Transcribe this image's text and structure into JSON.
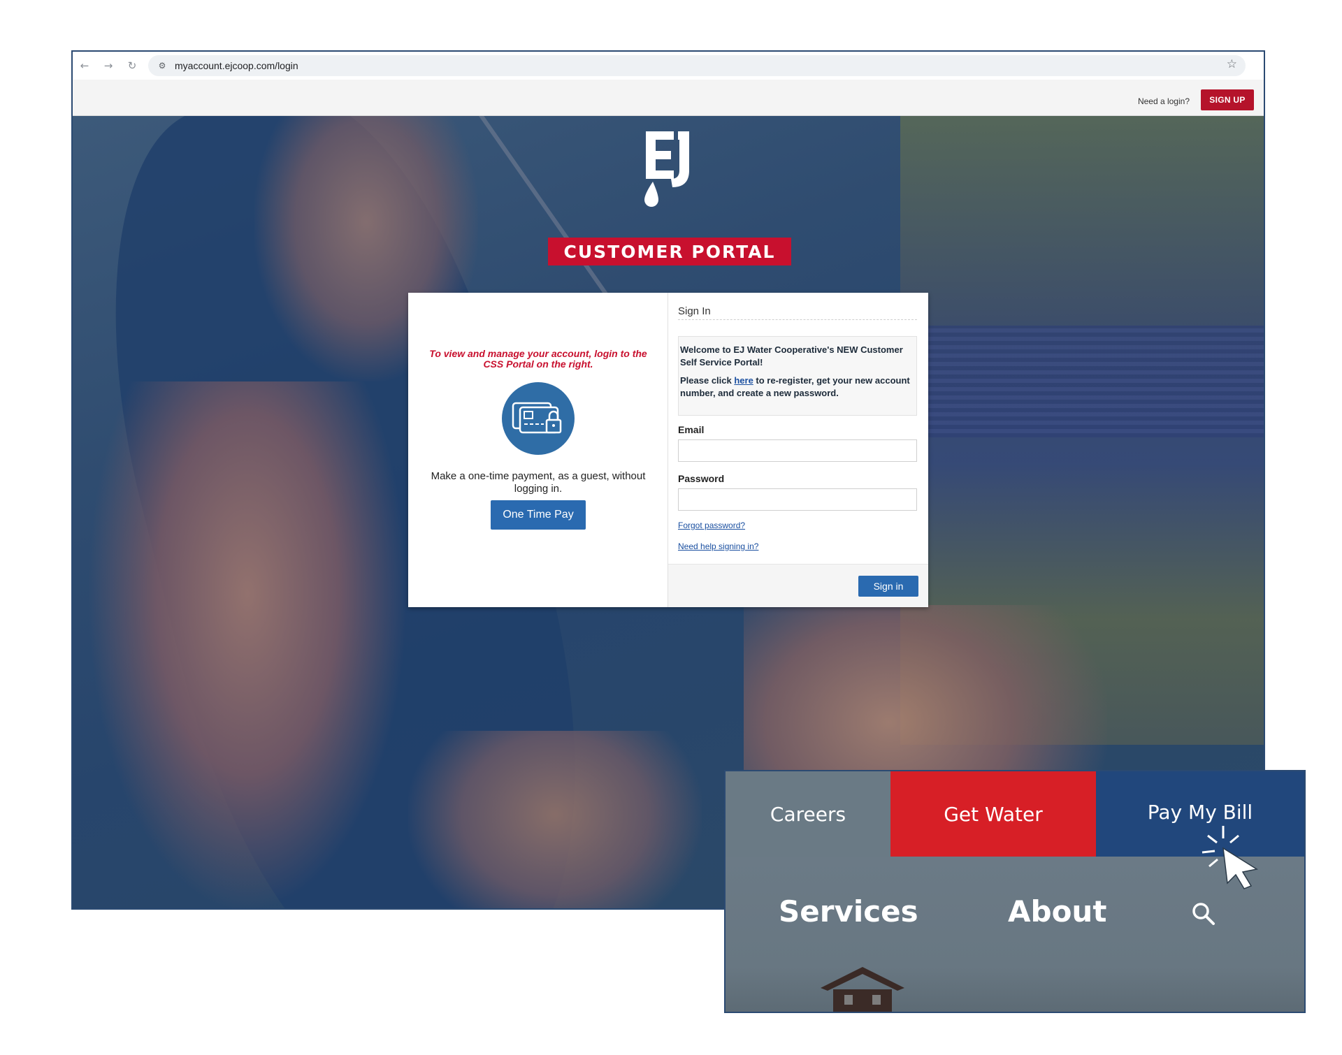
{
  "browser": {
    "url": "myaccount.ejcoop.com/login",
    "icons": {
      "back": "back-arrow-icon",
      "forward": "forward-arrow-icon",
      "reload": "reload-icon",
      "site": "site-settings-icon",
      "bookmark": "star-icon"
    }
  },
  "header": {
    "need_login": "Need a login?",
    "signup_label": "SIGN UP"
  },
  "brand": {
    "logo_text": "EJ",
    "banner": "CUSTOMER PORTAL",
    "colors": {
      "red": "#c8102e",
      "blue": "#2a6ab0",
      "navy": "#21477c"
    }
  },
  "guest": {
    "note": "To view and manage your account, login to the CSS Portal on the right.",
    "description": "Make a one-time payment, as a guest, without logging in.",
    "button_label": "One Time Pay",
    "icon": "credit-card-lock-icon"
  },
  "signin": {
    "title": "Sign In",
    "welcome_line": "Welcome to EJ Water Cooperative's NEW Customer Self Service Portal!",
    "instructions_before": "Please click ",
    "instructions_link": "here",
    "instructions_after": " to re-register, get your new account number, and create a new password.",
    "email_label": "Email",
    "email_value": "",
    "password_label": "Password",
    "password_value": "",
    "forgot_link": "Forgot password?",
    "help_link": "Need help signing in?",
    "button_label": "Sign in"
  },
  "site_nav": {
    "careers": "Careers",
    "get_water": "Get Water",
    "pay_bill": "Pay My Bill",
    "services": "Services",
    "about": "About",
    "search_icon": "search-icon",
    "cursor_icon": "click-cursor-icon"
  }
}
